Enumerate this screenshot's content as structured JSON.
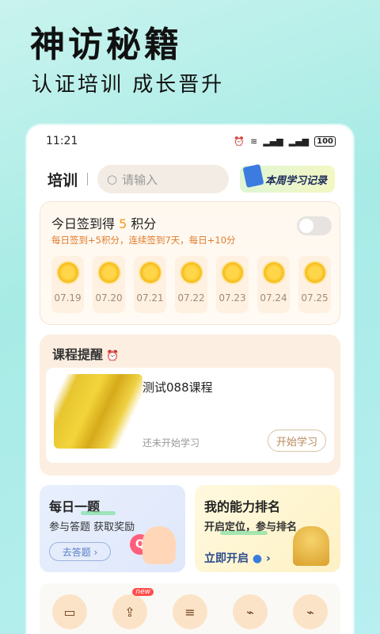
{
  "banner": {
    "title": "神访秘籍",
    "subtitle": "认证培训  成长晋升"
  },
  "status_bar": {
    "time": "11:21",
    "battery": "100"
  },
  "header": {
    "title": "培训",
    "search_placeholder": "请输入",
    "record_label": "本周学习记录"
  },
  "checkin": {
    "title_prefix": "今日签到得",
    "title_points": "5",
    "title_suffix": "积分",
    "description": "每日签到+5积分，连续签到7天，每日+10分",
    "toggle_on": false,
    "days": [
      "07.19",
      "07.20",
      "07.21",
      "07.22",
      "07.23",
      "07.24",
      "07.25"
    ]
  },
  "course_reminder": {
    "title": "课程提醒",
    "course_name": "测试088课程",
    "status": "还未开始学习",
    "start_label": "开始学习"
  },
  "daily_question": {
    "title": "每日一题",
    "description": "参与答题  获取奖励",
    "button": "去答题 ›"
  },
  "ranking": {
    "title": "我的能力排名",
    "description": "开启定位，参与排名",
    "button": "立即开启",
    "arrow": "›"
  },
  "bottom_badge": "new"
}
